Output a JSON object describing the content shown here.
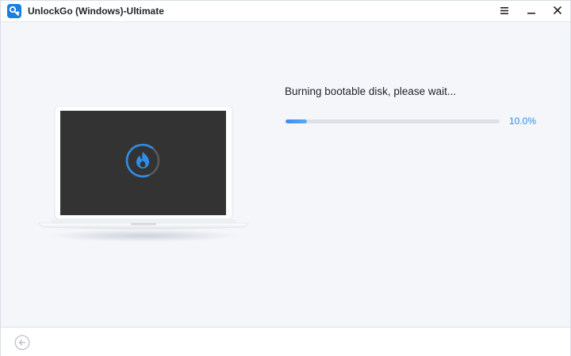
{
  "window": {
    "title": "UnlockGo (Windows)-Ultimate"
  },
  "titlebar": {
    "menu_icon": "menu-icon",
    "minimize_icon": "minimize-icon",
    "close_icon": "close-icon"
  },
  "main": {
    "status_text": "Burning bootable disk, please wait...",
    "progress": {
      "fraction": 0.1,
      "label": "10.0%"
    },
    "illustration": "laptop-burning-icon"
  },
  "footer": {
    "back_icon": "back-arrow-icon"
  },
  "colors": {
    "accent": "#2e8ee8",
    "background": "#f4f6fa",
    "screen": "#333333"
  }
}
